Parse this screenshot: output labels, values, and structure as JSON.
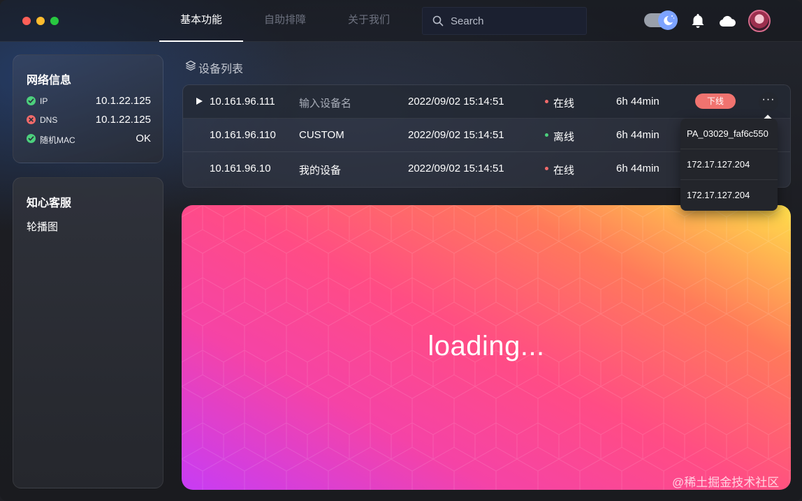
{
  "window": {
    "traffic_lights": [
      "close",
      "minimize",
      "maximize"
    ],
    "colors": {
      "close": "#fe5f57",
      "minimize": "#febc2e",
      "maximize": "#28c840"
    }
  },
  "header": {
    "tabs": [
      {
        "label": "基本功能",
        "active": true
      },
      {
        "label": "自助排障",
        "active": false
      },
      {
        "label": "关于我们",
        "active": false
      }
    ],
    "search": {
      "placeholder": "Search",
      "value": "",
      "icon": "search-icon"
    },
    "theme_toggle": {
      "state": "dark",
      "icon": "moon-icon"
    },
    "icons": [
      "bell-icon",
      "cloud-icon"
    ],
    "avatar": "user-avatar"
  },
  "network_card": {
    "title": "网络信息",
    "rows": [
      {
        "label": "IP",
        "value": "10.1.22.125",
        "status": "ok"
      },
      {
        "label": "DNS",
        "value": "10.1.22.125",
        "status": "error"
      },
      {
        "label": "随机MAC",
        "value": "OK",
        "status": "ok"
      }
    ]
  },
  "service_card": {
    "title": "知心客服",
    "item": "轮播图"
  },
  "device_list": {
    "title": "设备列表",
    "icon": "layers-icon",
    "rows": [
      {
        "ip": "10.161.96.111",
        "name": "输入设备名",
        "name_placeholder": true,
        "time": "2022/09/02 15:14:51",
        "status": "在线",
        "status_color": "#f26a6a",
        "uptime": "6h 44min",
        "action": "下线",
        "more": "···"
      },
      {
        "ip": "10.161.96.110",
        "name": "CUSTOM",
        "name_placeholder": false,
        "time": "2022/09/02 15:14:51",
        "status": "离线",
        "status_color": "#4cd07d",
        "uptime": "6h 44min"
      },
      {
        "ip": "10.161.96.10",
        "name": "我的设备",
        "name_placeholder": false,
        "time": "2022/09/02 15:14:51",
        "status": "在线",
        "status_color": "#f26a6a",
        "uptime": "6h 44min"
      }
    ]
  },
  "popover": {
    "items": [
      "PA_03029_faf6c550",
      "172.17.127.204",
      "172.17.127.204"
    ]
  },
  "banner": {
    "text": "loading..."
  },
  "watermark": "@稀土掘金技术社区"
}
